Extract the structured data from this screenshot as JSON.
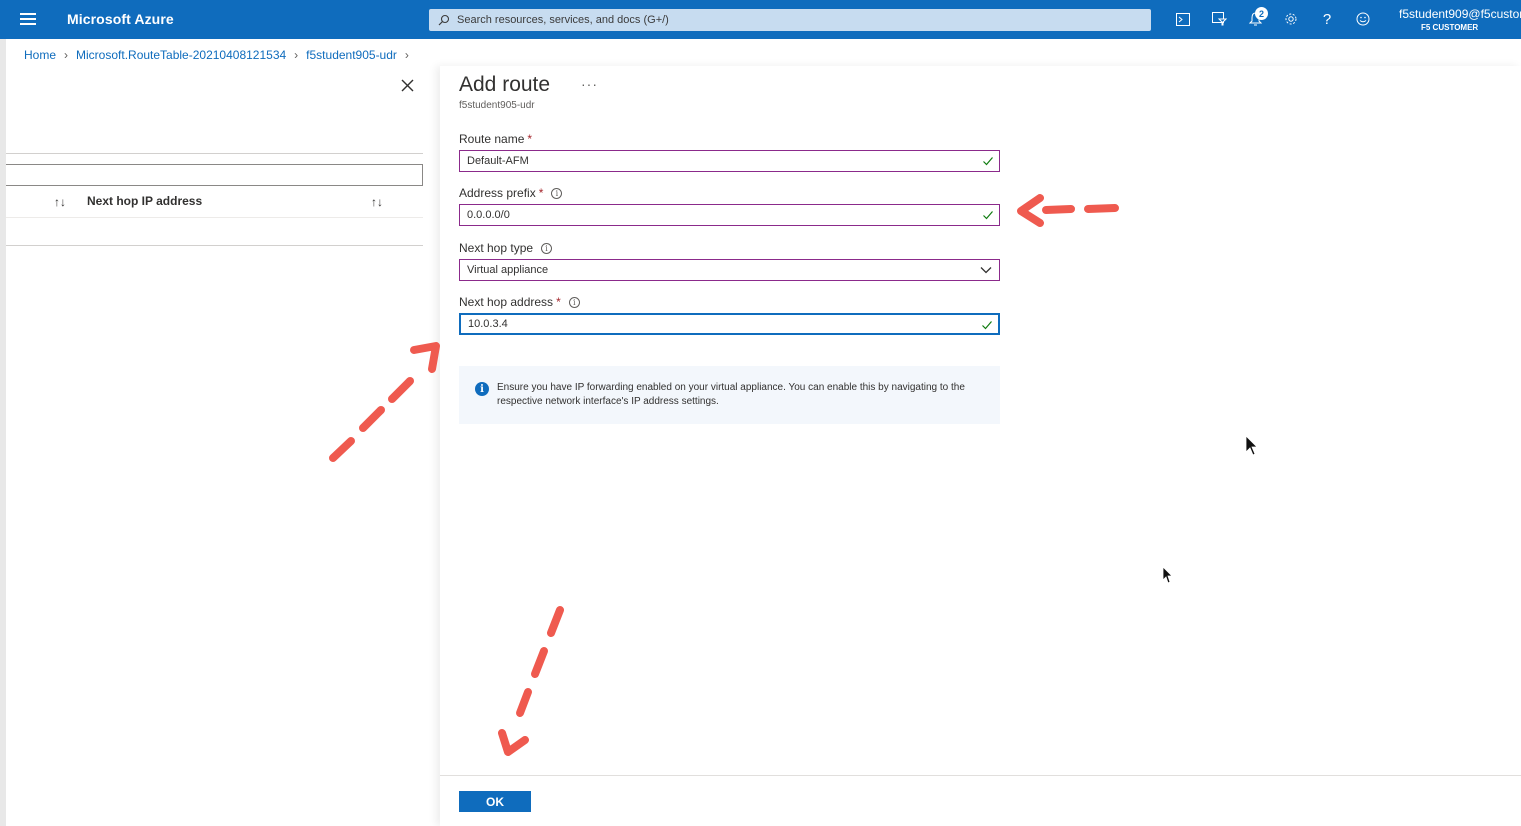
{
  "topbar": {
    "brand": "Microsoft Azure",
    "search_placeholder": "Search resources, services, and docs (G+/)",
    "notification_count": "2",
    "user_name": "f5student909@f5custome",
    "tenant": "F5 CUSTOMER",
    "icons": [
      "menu-icon",
      "cloud-shell-icon",
      "directory-filter-icon",
      "bell-icon",
      "gear-icon",
      "help-icon",
      "feedback-icon"
    ]
  },
  "breadcrumb": {
    "items": [
      "Home",
      "Microsoft.RouteTable-20210408121534",
      "f5student905-udr"
    ]
  },
  "left_blade": {
    "column_header": "Next hop IP address"
  },
  "panel": {
    "title": "Add route",
    "more": "···",
    "subtitle": "f5student905-udr",
    "route_name_label": "Route name",
    "route_name_value": "Default-AFM",
    "address_prefix_label": "Address prefix",
    "address_prefix_value": "0.0.0.0/0",
    "next_hop_type_label": "Next hop type",
    "next_hop_type_value": "Virtual appliance",
    "next_hop_address_label": "Next hop address",
    "next_hop_address_value": "10.0.3.4",
    "required_mark": "*",
    "info_text": "Ensure you have IP forwarding enabled on your virtual appliance. You can enable this by navigating to the respective network interface's IP address settings.",
    "ok_label": "OK"
  },
  "colors": {
    "azure_blue": "#0f6cbd",
    "field_border": "#8b2a8b",
    "annotation_arrow": "#ef5a4f"
  }
}
